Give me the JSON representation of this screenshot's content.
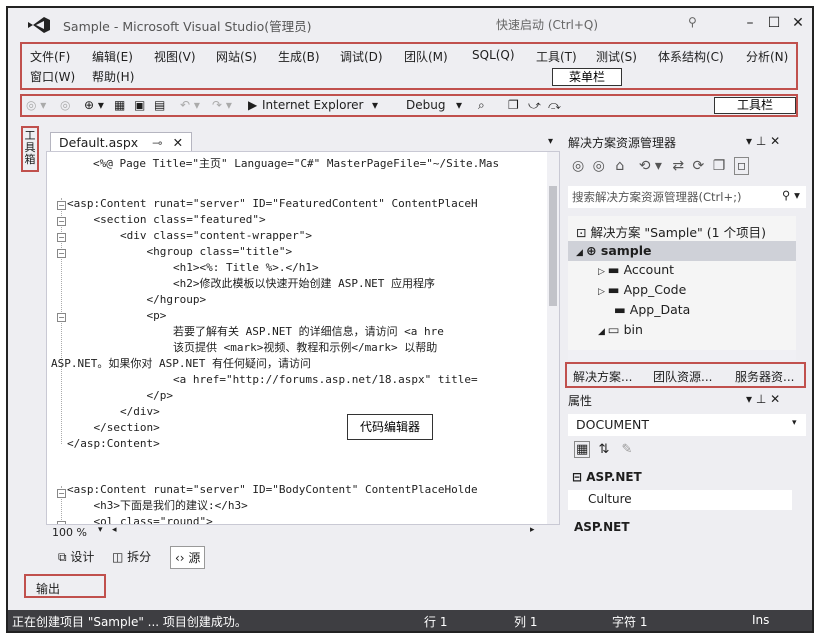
{
  "window": {
    "title": "Sample - Microsoft Visual Studio(管理员)",
    "quick_launch_placeholder": "快速启动 (Ctrl+Q)",
    "minimize": "–",
    "maximize": "☐",
    "close": "✕"
  },
  "menu": {
    "row1": [
      "文件(F)",
      "编辑(E)",
      "视图(V)",
      "网站(S)",
      "生成(B)",
      "调试(D)",
      "团队(M)",
      "SQL(Q)",
      "工具(T)",
      "测试(S)",
      "体系结构(C)",
      "分析(N)"
    ],
    "row2": [
      "窗口(W)",
      "帮助(H)"
    ]
  },
  "annotations": {
    "menu": "菜单栏",
    "toolbar": "工具栏",
    "editor": "代码编辑器"
  },
  "toolbar": {
    "browser": "Internet Explorer",
    "config": "Debug"
  },
  "toolbox_label": [
    "工",
    "具",
    "箱"
  ],
  "editor": {
    "tab_label": "Default.aspx",
    "lines": [
      "<%@ Page Title=\"主页\" Language=\"C#\" MasterPageFile=\"~/Site.Mas",
      "",
      "<asp:Content runat=\"server\" ID=\"FeaturedContent\" ContentPlaceH",
      "    <section class=\"featured\">",
      "        <div class=\"content-wrapper\">",
      "            <hgroup class=\"title\">",
      "                <h1><%: Title %>.</h1>",
      "                <h2>修改此模板以快速开始创建 ASP.NET 应用程序",
      "            </hgroup>",
      "            <p>",
      "                若要了解有关 ASP.NET 的详细信息，请访问 <a hre",
      "                该页提供 <mark>视频、教程和示例</mark> 以帮助",
      "ASP.NET。如果你对 ASP.NET 有任何疑问，请访问",
      "                <a href=\"http://forums.asp.net/18.aspx\" title=",
      "            </p>",
      "        </div>",
      "    </section>",
      "</asp:Content>",
      "",
      "<asp:Content runat=\"server\" ID=\"BodyContent\" ContentPlaceHolde",
      "    <h3>下面是我们的建议:</h3>",
      "    <ol class=\"round\">"
    ],
    "zoom": "100 %",
    "view_tabs": [
      "设计",
      "拆分",
      "源"
    ]
  },
  "output_tab": "输出",
  "solution_explorer": {
    "title": "解决方案资源管理器",
    "search_placeholder": "搜索解决方案资源管理器(Ctrl+;)",
    "items": [
      "解决方案 \"Sample\" (1 个项目)",
      "sample",
      "Account",
      "App_Code",
      "App_Data",
      "bin"
    ]
  },
  "bottom_tabs": [
    "解决方案...",
    "团队资源...",
    "服务器资..."
  ],
  "properties": {
    "title": "属性",
    "object": "DOCUMENT",
    "category": "ASP.NET",
    "row": "Culture",
    "description": "ASP.NET"
  },
  "status": {
    "message": "正在创建项目 \"Sample\" ... 项目创建成功。",
    "line": "行 1",
    "col": "列 1",
    "char": "字符 1",
    "mode": "Ins"
  },
  "colors": {
    "highlight_border": "#c0504d",
    "status_bar": "#3e3e42",
    "vs_purple": "#68217a"
  }
}
